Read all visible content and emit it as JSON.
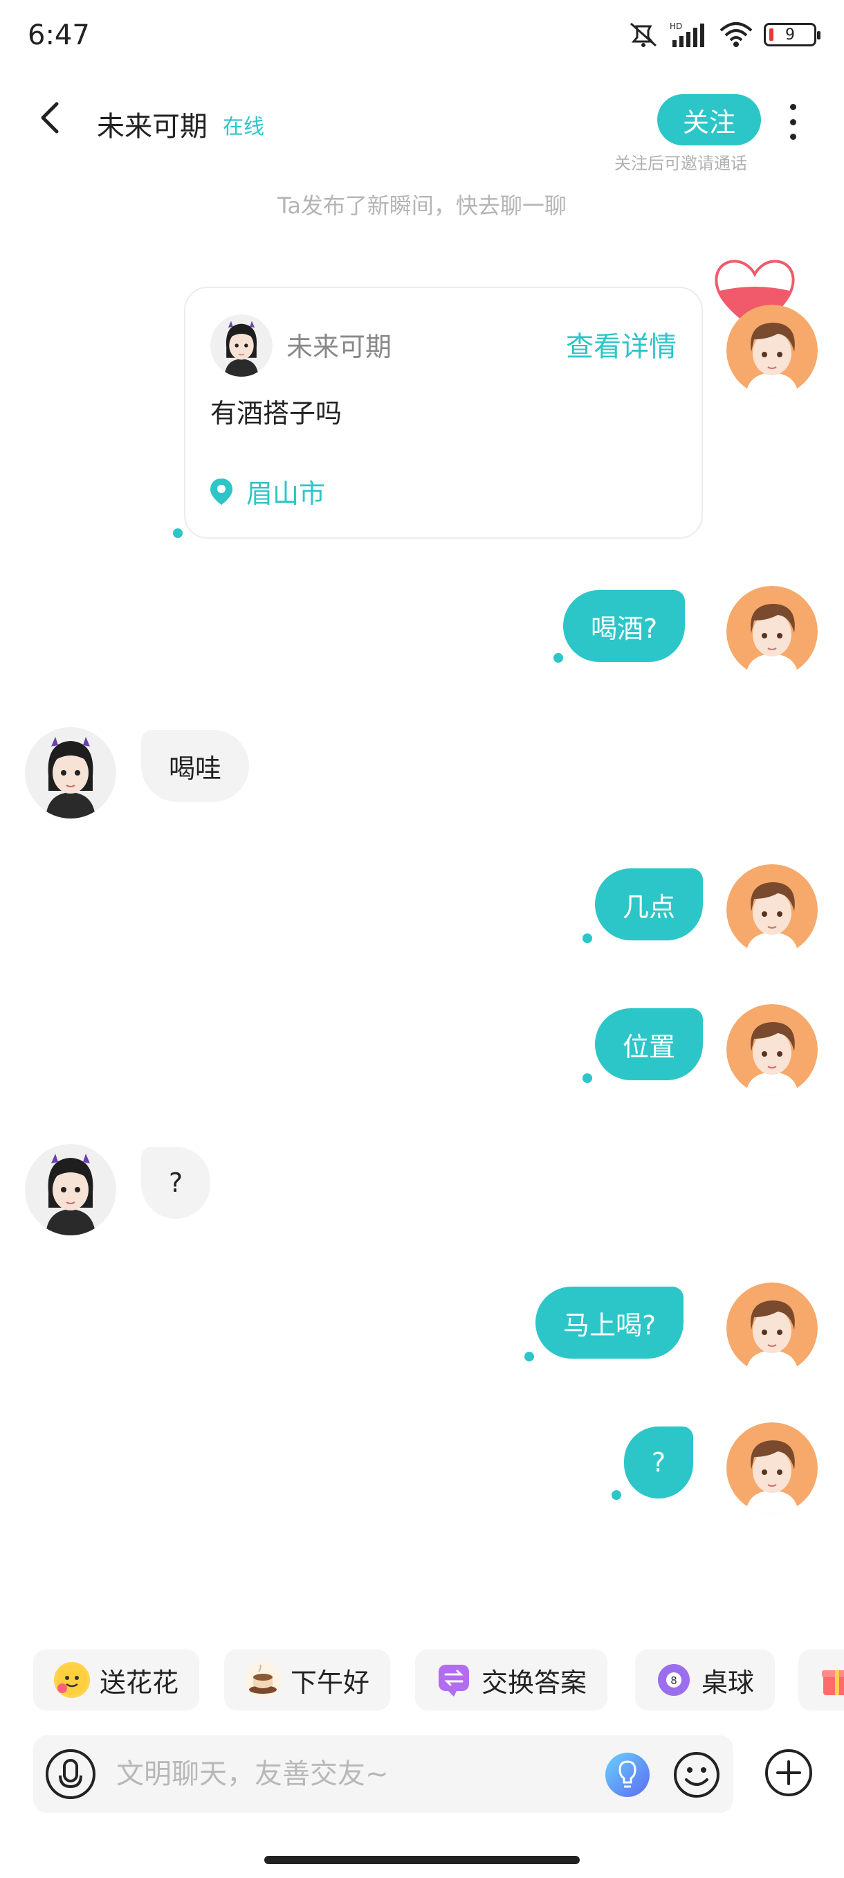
{
  "status_bar": {
    "time": "6:47",
    "battery": "9",
    "icons": [
      "mute-icon",
      "hd-signal-icon",
      "wifi-icon",
      "battery-icon"
    ]
  },
  "header": {
    "title": "未来可期",
    "online_status": "在线",
    "follow_label": "关注",
    "follow_hint": "关注后可邀请通话"
  },
  "system_notice": "Ta发布了新瞬间，快去聊一聊",
  "moment_card": {
    "author": "未来可期",
    "detail_link": "查看详情",
    "text": "有酒搭子吗",
    "location": "眉山市"
  },
  "messages": [
    {
      "direction": "out",
      "text": "喝酒?"
    },
    {
      "direction": "in",
      "text": "喝哇"
    },
    {
      "direction": "out",
      "text": "几点"
    },
    {
      "direction": "out",
      "text": "位置"
    },
    {
      "direction": "in",
      "text": "?"
    },
    {
      "direction": "out",
      "text": "马上喝?"
    },
    {
      "direction": "out",
      "text": "?"
    }
  ],
  "quick_replies": [
    {
      "label": "送花花",
      "icon": "flower-face-icon"
    },
    {
      "label": "下午好",
      "icon": "coffee-icon"
    },
    {
      "label": "交换答案",
      "icon": "exchange-icon"
    },
    {
      "label": "桌球",
      "icon": "billiard-ball-icon"
    },
    {
      "label": "",
      "icon": "gift-icon"
    }
  ],
  "input": {
    "placeholder": "文明聊天，友善交友~"
  },
  "colors": {
    "accent": "#2cc6c8",
    "bubble_in": "#f3f3f3",
    "my_avatar_bg": "#f6a96b"
  }
}
